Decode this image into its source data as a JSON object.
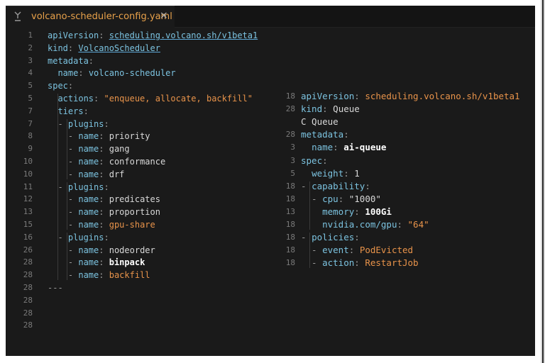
{
  "tab": {
    "icon": "split-editor-icon",
    "label": "volcano-scheduler-config.yaml",
    "close": "×"
  },
  "left_editor": {
    "lines": [
      {
        "num": "1",
        "indent": "",
        "key": "apiVersion",
        "sep": ": ",
        "value": "scheduling.volcano.sh/v1beta1",
        "vclass": "k u"
      },
      {
        "num": "2",
        "indent": "",
        "key": "kind",
        "sep": ": ",
        "value": "VolcanoScheduler",
        "vclass": "k u"
      },
      {
        "num": "3",
        "indent": "",
        "key": "metadata",
        "sep": ":",
        "value": "",
        "vclass": "v"
      },
      {
        "num": "4",
        "indent": "  ",
        "key": "name",
        "sep": ": ",
        "value": "volcano-scheduler",
        "vclass": "k"
      },
      {
        "num": "5",
        "indent": "",
        "key": "spec",
        "sep": ":",
        "value": "",
        "vclass": "v"
      },
      {
        "num": "5",
        "indent": "  ",
        "key": "actions",
        "sep": ": ",
        "value": "\"enqueue, allocate, backfill\"",
        "vclass": "s"
      },
      {
        "num": "7",
        "indent": "  ",
        "key": "tiers",
        "sep": ":",
        "value": "",
        "vclass": "v"
      },
      {
        "num": "7",
        "indent": "  - ",
        "key": "plugins",
        "sep": ":",
        "value": "",
        "vclass": "v"
      },
      {
        "num": "8",
        "indent": "    - ",
        "key": "name",
        "sep": ": ",
        "value": "priority",
        "vclass": "v"
      },
      {
        "num": "9",
        "indent": "    - ",
        "key": "name",
        "sep": ": ",
        "value": "gang",
        "vclass": "v"
      },
      {
        "num": "10",
        "indent": "    - ",
        "key": "name",
        "sep": ": ",
        "value": "conformance",
        "vclass": "v"
      },
      {
        "num": "10",
        "indent": "    - ",
        "key": "name",
        "sep": ": ",
        "value": "drf",
        "vclass": "v"
      },
      {
        "num": "11",
        "indent": "  - ",
        "key": "plugins",
        "sep": ":",
        "value": "",
        "vclass": "v"
      },
      {
        "num": "12",
        "indent": "    - ",
        "key": "name",
        "sep": ": ",
        "value": "predicates",
        "vclass": "v"
      },
      {
        "num": "13",
        "indent": "    - ",
        "key": "name",
        "sep": ": ",
        "value": "proportion",
        "vclass": "v"
      },
      {
        "num": "15",
        "indent": "    - ",
        "key": "name",
        "sep": ": ",
        "value": "gpu-share",
        "vclass": "s"
      },
      {
        "num": "16",
        "indent": "  - ",
        "key": "plugins",
        "sep": ":",
        "value": "",
        "vclass": "v"
      },
      {
        "num": "26",
        "indent": "    - ",
        "key": "name",
        "sep": ": ",
        "value": "nodeorder",
        "vclass": "v"
      },
      {
        "num": "28",
        "indent": "    - ",
        "key": "name",
        "sep": ": ",
        "value": "binpack",
        "vclass": "w"
      },
      {
        "num": "28",
        "indent": "    - ",
        "key": "name",
        "sep": ": ",
        "value": "backfill",
        "vclass": "s"
      },
      {
        "num": "28",
        "indent": "",
        "key": "",
        "sep": "",
        "value": "---",
        "vclass": "p"
      },
      {
        "num": "28",
        "indent": "",
        "key": "",
        "sep": "",
        "value": "",
        "vclass": "v"
      },
      {
        "num": "28",
        "indent": "",
        "key": "",
        "sep": "",
        "value": "",
        "vclass": "v"
      },
      {
        "num": "28",
        "indent": "",
        "key": "",
        "sep": "",
        "value": "",
        "vclass": "v"
      }
    ]
  },
  "right_editor": {
    "lines": [
      {
        "num": "18",
        "indent": "",
        "key": "apiVersion",
        "sep": ": ",
        "value": "scheduling.volcano.sh/v1beta1",
        "vclass": "s"
      },
      {
        "num": "28",
        "indent": "",
        "key": "kind",
        "sep": ": ",
        "value": "Queue",
        "vclass": "v"
      },
      {
        "num": "",
        "indent": "",
        "key": "",
        "sep": "",
        "value": "C Queue",
        "vclass": "v"
      },
      {
        "num": "28",
        "indent": "",
        "key": "metadata",
        "sep": ":",
        "value": "",
        "vclass": "v"
      },
      {
        "num": "3",
        "indent": "  ",
        "key": "name",
        "sep": ": ",
        "value": "ai-queue",
        "vclass": "w"
      },
      {
        "num": "3",
        "indent": "",
        "key": "spec",
        "sep": ":",
        "value": "",
        "vclass": "v"
      },
      {
        "num": "5",
        "indent": "  ",
        "key": "weight",
        "sep": ": ",
        "value": "1",
        "vclass": "v"
      },
      {
        "num": "18",
        "indent": "- ",
        "key": "capability",
        "sep": ":",
        "value": "",
        "vclass": "v"
      },
      {
        "num": "18",
        "indent": "  - ",
        "key": "cpu",
        "sep": ": ",
        "value": "\"1000\"",
        "vclass": "v"
      },
      {
        "num": "13",
        "indent": "    ",
        "key": "memory",
        "sep": ": ",
        "value": "100Gi",
        "vclass": "w"
      },
      {
        "num": "18",
        "indent": "    ",
        "key": "nvidia.com/gpu",
        "sep": ": ",
        "value": "\"64\"",
        "vclass": "s"
      },
      {
        "num": "18",
        "indent": "- ",
        "key": "policies",
        "sep": ":",
        "value": "",
        "vclass": "v"
      },
      {
        "num": "18",
        "indent": "  - ",
        "key": "event",
        "sep": ": ",
        "value": "PodEvicted",
        "vclass": "s"
      },
      {
        "num": "18",
        "indent": "  - ",
        "key": "action",
        "sep": ": ",
        "value": "RestartJob",
        "vclass": "s"
      }
    ]
  },
  "colors": {
    "background": "#1a1a1a",
    "key": "#7cc3e0",
    "string": "#e8934a",
    "text": "#d8d8d8",
    "line_number": "#7a7a7a",
    "tab_label": "#e8a14a"
  }
}
